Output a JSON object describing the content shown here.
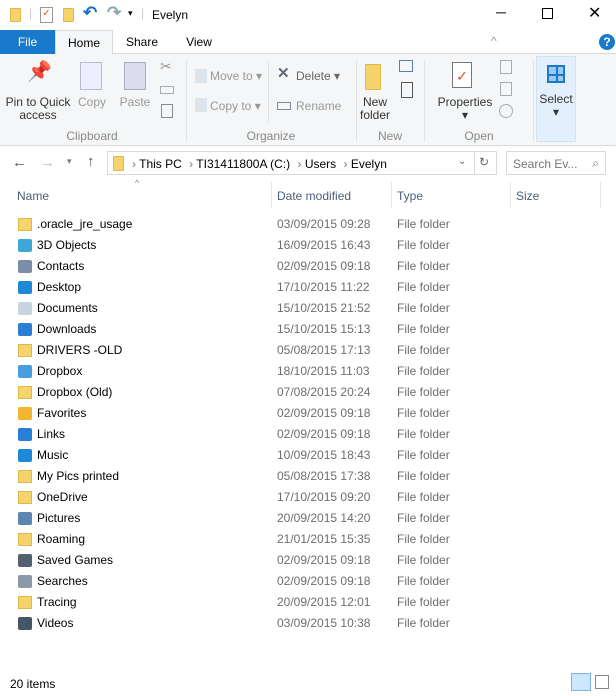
{
  "window": {
    "title": "Evelyn"
  },
  "tabs": [
    {
      "label": "File"
    },
    {
      "label": "Home"
    },
    {
      "label": "Share"
    },
    {
      "label": "View"
    }
  ],
  "ribbon": {
    "pin": "Pin to Quick access",
    "copy": "Copy",
    "paste": "Paste",
    "clipboard": "Clipboard",
    "move_to": "Move to",
    "copy_to": "Copy to",
    "delete": "Delete",
    "rename": "Rename",
    "organize": "Organize",
    "new_folder": "New folder",
    "new": "New",
    "properties": "Properties",
    "open": "Open",
    "select": "Select"
  },
  "address": {
    "crumbs": [
      "This PC",
      "TI31411800A (C:)",
      "Users",
      "Evelyn"
    ]
  },
  "search": {
    "placeholder": "Search Ev..."
  },
  "columns": [
    "Name",
    "Date modified",
    "Type",
    "Size"
  ],
  "files": [
    {
      "name": ".oracle_jre_usage",
      "date": "03/09/2015 09:28",
      "type": "File folder",
      "icon": "folder",
      "color": "#f5d46e"
    },
    {
      "name": "3D Objects",
      "date": "16/09/2015 16:43",
      "type": "File folder",
      "icon": "3d-objects",
      "color": "#3fa7d6"
    },
    {
      "name": "Contacts",
      "date": "02/09/2015 09:18",
      "type": "File folder",
      "icon": "contacts",
      "color": "#7a8fa6"
    },
    {
      "name": "Desktop",
      "date": "17/10/2015 11:22",
      "type": "File folder",
      "icon": "desktop",
      "color": "#1e88d8"
    },
    {
      "name": "Documents",
      "date": "15/10/2015 21:52",
      "type": "File folder",
      "icon": "documents",
      "color": "#c8d4e0"
    },
    {
      "name": "Downloads",
      "date": "15/10/2015 15:13",
      "type": "File folder",
      "icon": "downloads",
      "color": "#2a7fd4"
    },
    {
      "name": "DRIVERS -OLD",
      "date": "05/08/2015 17:13",
      "type": "File folder",
      "icon": "folder",
      "color": "#f5d46e"
    },
    {
      "name": "Dropbox",
      "date": "18/10/2015 11:03",
      "type": "File folder",
      "icon": "dropbox",
      "color": "#4a9ee0"
    },
    {
      "name": "Dropbox (Old)",
      "date": "07/08/2015 20:24",
      "type": "File folder",
      "icon": "folder",
      "color": "#f5d46e"
    },
    {
      "name": "Favorites",
      "date": "02/09/2015 09:18",
      "type": "File folder",
      "icon": "favorites",
      "color": "#f2b632"
    },
    {
      "name": "Links",
      "date": "02/09/2015 09:18",
      "type": "File folder",
      "icon": "links",
      "color": "#2a7fd4"
    },
    {
      "name": "Music",
      "date": "10/09/2015 18:43",
      "type": "File folder",
      "icon": "music",
      "color": "#1e88d8"
    },
    {
      "name": "My Pics printed",
      "date": "05/08/2015 17:38",
      "type": "File folder",
      "icon": "folder",
      "color": "#f5d46e"
    },
    {
      "name": "OneDrive",
      "date": "17/10/2015 09:20",
      "type": "File folder",
      "icon": "folder",
      "color": "#f5d46e"
    },
    {
      "name": "Pictures",
      "date": "20/09/2015 14:20",
      "type": "File folder",
      "icon": "pictures",
      "color": "#5a86b0"
    },
    {
      "name": "Roaming",
      "date": "21/01/2015 15:35",
      "type": "File folder",
      "icon": "folder",
      "color": "#f5d46e"
    },
    {
      "name": "Saved Games",
      "date": "02/09/2015 09:18",
      "type": "File folder",
      "icon": "saved-games",
      "color": "#55606e"
    },
    {
      "name": "Searches",
      "date": "02/09/2015 09:18",
      "type": "File folder",
      "icon": "searches",
      "color": "#8a98a8"
    },
    {
      "name": "Tracing",
      "date": "20/09/2015 12:01",
      "type": "File folder",
      "icon": "folder",
      "color": "#f5d46e"
    },
    {
      "name": "Videos",
      "date": "03/09/2015 10:38",
      "type": "File folder",
      "icon": "videos",
      "color": "#445566"
    }
  ],
  "status": {
    "count": "20 items"
  }
}
